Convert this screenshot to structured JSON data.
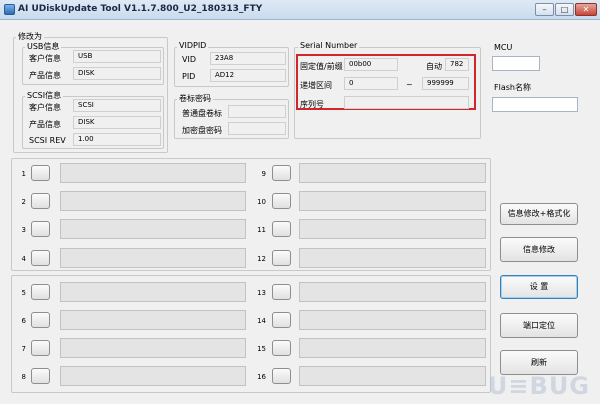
{
  "window": {
    "title": "AI UDiskUpdate Tool V1.1.7.800_U2_180313_FTY",
    "min": "–",
    "max": "□",
    "close": "✕"
  },
  "modify": {
    "group_label": "修改为",
    "usb": {
      "label": "USB信息",
      "customer_label": "客户信息",
      "customer_value": "USB",
      "product_label": "产品信息",
      "product_value": "DISK"
    },
    "scsi": {
      "label": "SCSI信息",
      "customer_label": "客户信息",
      "customer_value": "SCSI",
      "product_label": "产品信息",
      "product_value": "DISK",
      "rev_label": "SCSI REV",
      "rev_value": "1.00"
    }
  },
  "vidpid": {
    "label": "VIDPID",
    "vid_label": "VID",
    "vid_value": "23A8",
    "pid_label": "PID",
    "pid_value": "AD12"
  },
  "volume": {
    "label": "卷标密码",
    "normal_label": "普通盘卷标",
    "normal_value": "",
    "encrypt_label": "加密盘密码",
    "encrypt_value": ""
  },
  "serial": {
    "label": "Serial Number",
    "fixed_label": "固定值/前缀",
    "fixed_value": "00b00",
    "auto_label": "自动",
    "auto_value": "782",
    "range_label": "递增区间",
    "range_start": "0",
    "range_sep": "~",
    "range_end": "999999",
    "serial_label": "序列号",
    "serial_value": ""
  },
  "mcu": {
    "label": "MCU",
    "value": ""
  },
  "flash": {
    "label": "Flash名称",
    "value": ""
  },
  "ports": {
    "group1_left": [
      "1",
      "2",
      "3",
      "4"
    ],
    "group1_right": [
      "9",
      "10",
      "11",
      "12"
    ],
    "group2_left": [
      "5",
      "6",
      "7",
      "8"
    ],
    "group2_right": [
      "13",
      "14",
      "15",
      "16"
    ]
  },
  "actions": {
    "modify_format": "信息修改+格式化",
    "modify": "信息修改",
    "settings": "设 置",
    "port_locate": "端口定位",
    "refresh": "刷新"
  },
  "watermark": "U≡BUG"
}
